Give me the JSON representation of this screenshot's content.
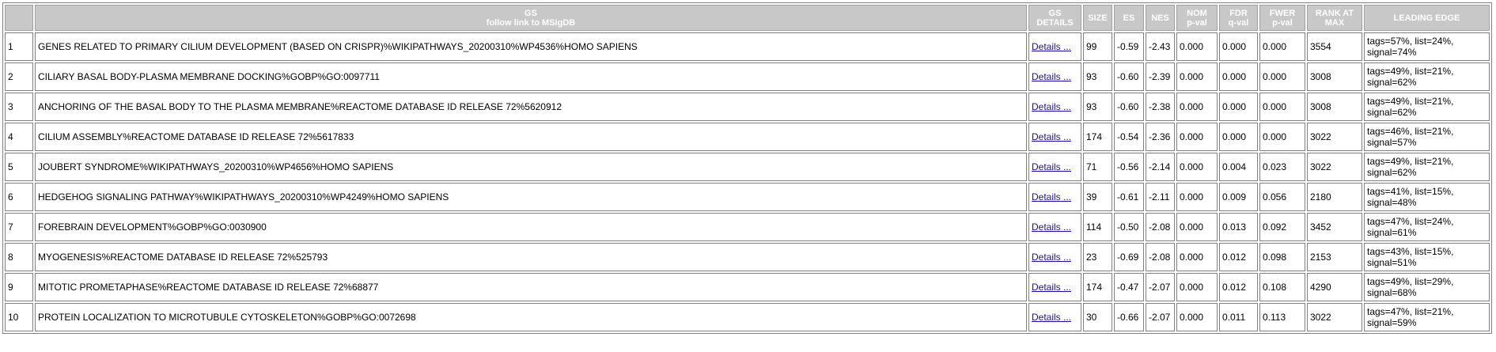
{
  "headers": {
    "index": "",
    "gs_main": "GS",
    "gs_sub": "follow link to MSigDB",
    "details_line1": "GS",
    "details_line2": "DETAILS",
    "size": "SIZE",
    "es": "ES",
    "nes": "NES",
    "nom_line1": "NOM",
    "nom_line2": "p-val",
    "fdr_line1": "FDR",
    "fdr_line2": "q-val",
    "fwer_line1": "FWER",
    "fwer_line2": "p-val",
    "rank_line1": "RANK AT",
    "rank_line2": "MAX",
    "edge": "LEADING EDGE"
  },
  "rows": [
    {
      "index": "1",
      "name": "GENES RELATED TO PRIMARY CILIUM DEVELOPMENT (BASED ON CRISPR)%WIKIPATHWAYS_20200310%WP4536%HOMO SAPIENS",
      "details": "Details ...",
      "size": "99",
      "es": "-0.59",
      "nes": "-2.43",
      "nom": "0.000",
      "fdr": "0.000",
      "fwer": "0.000",
      "rank": "3554",
      "edge_line1": "tags=57%, list=24%,",
      "edge_line2": "signal=74%"
    },
    {
      "index": "2",
      "name": "CILIARY BASAL BODY-PLASMA MEMBRANE DOCKING%GOBP%GO:0097711",
      "details": "Details ...",
      "size": "93",
      "es": "-0.60",
      "nes": "-2.39",
      "nom": "0.000",
      "fdr": "0.000",
      "fwer": "0.000",
      "rank": "3008",
      "edge_line1": "tags=49%, list=21%,",
      "edge_line2": "signal=62%"
    },
    {
      "index": "3",
      "name": "ANCHORING OF THE BASAL BODY TO THE PLASMA MEMBRANE%REACTOME DATABASE ID RELEASE 72%5620912",
      "details": "Details ...",
      "size": "93",
      "es": "-0.60",
      "nes": "-2.38",
      "nom": "0.000",
      "fdr": "0.000",
      "fwer": "0.000",
      "rank": "3008",
      "edge_line1": "tags=49%, list=21%,",
      "edge_line2": "signal=62%"
    },
    {
      "index": "4",
      "name": "CILIUM ASSEMBLY%REACTOME DATABASE ID RELEASE 72%5617833",
      "details": "Details ...",
      "size": "174",
      "es": "-0.54",
      "nes": "-2.36",
      "nom": "0.000",
      "fdr": "0.000",
      "fwer": "0.000",
      "rank": "3022",
      "edge_line1": "tags=46%, list=21%,",
      "edge_line2": "signal=57%"
    },
    {
      "index": "5",
      "name": "JOUBERT SYNDROME%WIKIPATHWAYS_20200310%WP4656%HOMO SAPIENS",
      "details": "Details ...",
      "size": "71",
      "es": "-0.56",
      "nes": "-2.14",
      "nom": "0.000",
      "fdr": "0.004",
      "fwer": "0.023",
      "rank": "3022",
      "edge_line1": "tags=49%, list=21%,",
      "edge_line2": "signal=62%"
    },
    {
      "index": "6",
      "name": "HEDGEHOG SIGNALING PATHWAY%WIKIPATHWAYS_20200310%WP4249%HOMO SAPIENS",
      "details": "Details ...",
      "size": "39",
      "es": "-0.61",
      "nes": "-2.11",
      "nom": "0.000",
      "fdr": "0.009",
      "fwer": "0.056",
      "rank": "2180",
      "edge_line1": "tags=41%, list=15%,",
      "edge_line2": "signal=48%"
    },
    {
      "index": "7",
      "name": "FOREBRAIN DEVELOPMENT%GOBP%GO:0030900",
      "details": "Details ...",
      "size": "114",
      "es": "-0.50",
      "nes": "-2.08",
      "nom": "0.000",
      "fdr": "0.013",
      "fwer": "0.092",
      "rank": "3452",
      "edge_line1": "tags=47%, list=24%,",
      "edge_line2": "signal=61%"
    },
    {
      "index": "8",
      "name": "MYOGENESIS%REACTOME DATABASE ID RELEASE 72%525793",
      "details": "Details ...",
      "size": "23",
      "es": "-0.69",
      "nes": "-2.08",
      "nom": "0.000",
      "fdr": "0.012",
      "fwer": "0.098",
      "rank": "2153",
      "edge_line1": "tags=43%, list=15%,",
      "edge_line2": "signal=51%"
    },
    {
      "index": "9",
      "name": "MITOTIC PROMETAPHASE%REACTOME DATABASE ID RELEASE 72%68877",
      "details": "Details ...",
      "size": "174",
      "es": "-0.47",
      "nes": "-2.07",
      "nom": "0.000",
      "fdr": "0.012",
      "fwer": "0.108",
      "rank": "4290",
      "edge_line1": "tags=49%, list=29%,",
      "edge_line2": "signal=68%"
    },
    {
      "index": "10",
      "name": "PROTEIN LOCALIZATION TO MICROTUBULE CYTOSKELETON%GOBP%GO:0072698",
      "details": "Details ...",
      "size": "30",
      "es": "-0.66",
      "nes": "-2.07",
      "nom": "0.000",
      "fdr": "0.011",
      "fwer": "0.113",
      "rank": "3022",
      "edge_line1": "tags=47%, list=21%,",
      "edge_line2": "signal=59%"
    }
  ]
}
